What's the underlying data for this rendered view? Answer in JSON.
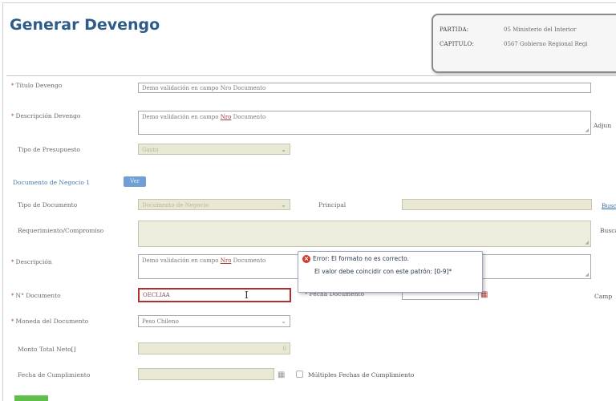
{
  "header": {
    "title": "Generar Devengo"
  },
  "info_box": {
    "partida_label": "PARTIDA:",
    "partida_value": "05 Ministerio del Interior",
    "capitulo_label": "CAPITULO:",
    "capitulo_value": "0567 Gobierno Regional Regi"
  },
  "form": {
    "titulo_label": "Título Devengo",
    "titulo_value": "Demo validación en campo Nro Documento",
    "descripcion_label": "Descripción Devengo",
    "descripcion_value_pre": "Demo validación en campo ",
    "descripcion_value_nro": "Nro",
    "descripcion_value_post": " Documento",
    "adjuntar_label": "Adjun",
    "tipo_presupuesto_label": "Tipo de Presupuesto",
    "tipo_presupuesto_value": "Gasto"
  },
  "section": {
    "link": "Documento de Negocio 1",
    "tag": "Ver"
  },
  "documento": {
    "tipo_documento_label": "Tipo de Documento",
    "tipo_documento_value": "Documento de Negocio",
    "principal_label": "Principal",
    "buscar_label": "Busca",
    "requerimiento_label": "Requerimiento/Compromiso",
    "buscar2_label": "Busca",
    "descripcion_label": "Descripción",
    "descripcion_value_pre": "Demo validación en campo ",
    "descripcion_value_nro": "Nro",
    "descripcion_value_post": " Documento",
    "numero_label": "N° Documento",
    "numero_value": "OECLIAA",
    "fecha_documento_label": "Fecha Documento",
    "campo_label": "Camp",
    "moneda_label": "Moneda del Documento",
    "moneda_value": "Peso Chileno",
    "monto_label": "Monto Total Neto[]",
    "monto_value": "0",
    "fecha_cumplimiento_label": "Fecha de Cumplimiento",
    "multiples_label": "Múltiples Fechas de Cumplimiento"
  },
  "tooltip": {
    "title": "Error: El formato no es correcto.",
    "message": "El valor debe coincidir con este patrón: [0-9]*"
  },
  "icons": {
    "error": "error-x-icon",
    "dropdown": "chevron-down-icon",
    "calendar": "calendar-icon"
  },
  "colors": {
    "title": "#2e5c8a",
    "error": "#b03030",
    "disabled_bg": "#e8e8d4",
    "link": "#2a6ab0",
    "success": "#5fbf4a"
  }
}
